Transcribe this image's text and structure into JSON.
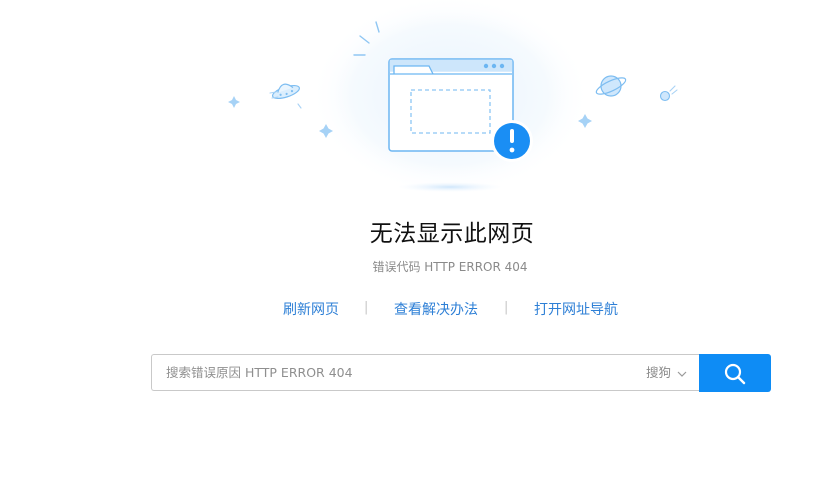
{
  "error": {
    "title": "无法显示此网页",
    "code_text": "错误代码 HTTP ERROR 404"
  },
  "actions": {
    "refresh": "刷新网页",
    "solutions": "查看解决办法",
    "nav": "打开网址导航",
    "separator": "|"
  },
  "search": {
    "placeholder": "搜索错误原因 HTTP ERROR 404",
    "engine": "搜狗"
  },
  "colors": {
    "accent": "#0e8cf5",
    "link": "#2d7fd6",
    "illustration": "#6cb6f2",
    "alert": "#1a8ef4"
  },
  "icons": {
    "illustration": "browser-window-error-icon",
    "alert": "exclamation-icon",
    "search": "magnifier-icon",
    "dropdown": "chevron-down-icon"
  }
}
